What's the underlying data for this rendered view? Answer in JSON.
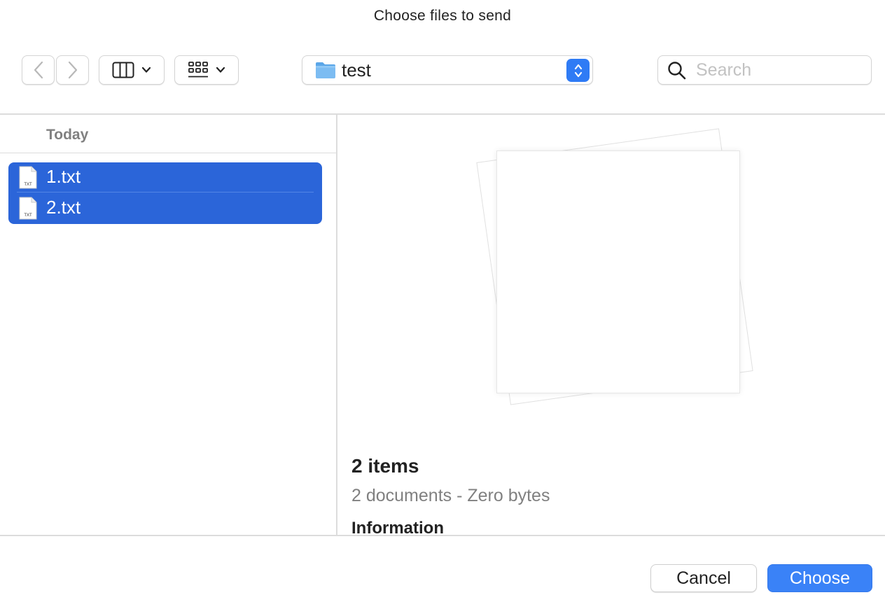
{
  "window": {
    "title": "Choose files to send"
  },
  "toolbar": {
    "back_icon": "chevron-left-icon",
    "forward_icon": "chevron-right-icon",
    "view_icon": "columns-view-icon",
    "group_icon": "icon-grid-icon",
    "location": {
      "label": "test",
      "icon": "folder-icon",
      "accent": "#2f7bf5"
    },
    "search": {
      "placeholder": "Search",
      "value": ""
    }
  },
  "file_list": {
    "group_header": "Today",
    "selection_color": "#2b65d9",
    "files": [
      {
        "name": "1.txt",
        "icon": "txt-file-icon",
        "icon_label": "TXT",
        "selected": true
      },
      {
        "name": "2.txt",
        "icon": "txt-file-icon",
        "icon_label": "TXT",
        "selected": true
      }
    ]
  },
  "preview": {
    "items_title": "2 items",
    "items_subtitle": "2 documents - Zero bytes",
    "info_heading": "Information"
  },
  "buttons": {
    "cancel": "Cancel",
    "choose": "Choose",
    "choose_color": "#3a82f7"
  }
}
